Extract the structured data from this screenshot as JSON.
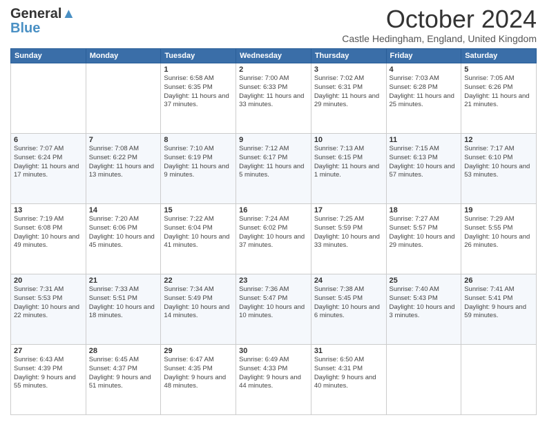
{
  "logo": {
    "line1": "General",
    "line2": "Blue",
    "bird": "▲"
  },
  "title": "October 2024",
  "location": "Castle Hedingham, England, United Kingdom",
  "weekdays": [
    "Sunday",
    "Monday",
    "Tuesday",
    "Wednesday",
    "Thursday",
    "Friday",
    "Saturday"
  ],
  "weeks": [
    [
      {
        "day": "",
        "info": ""
      },
      {
        "day": "",
        "info": ""
      },
      {
        "day": "1",
        "info": "Sunrise: 6:58 AM\nSunset: 6:35 PM\nDaylight: 11 hours and 37 minutes."
      },
      {
        "day": "2",
        "info": "Sunrise: 7:00 AM\nSunset: 6:33 PM\nDaylight: 11 hours and 33 minutes."
      },
      {
        "day": "3",
        "info": "Sunrise: 7:02 AM\nSunset: 6:31 PM\nDaylight: 11 hours and 29 minutes."
      },
      {
        "day": "4",
        "info": "Sunrise: 7:03 AM\nSunset: 6:28 PM\nDaylight: 11 hours and 25 minutes."
      },
      {
        "day": "5",
        "info": "Sunrise: 7:05 AM\nSunset: 6:26 PM\nDaylight: 11 hours and 21 minutes."
      }
    ],
    [
      {
        "day": "6",
        "info": "Sunrise: 7:07 AM\nSunset: 6:24 PM\nDaylight: 11 hours and 17 minutes."
      },
      {
        "day": "7",
        "info": "Sunrise: 7:08 AM\nSunset: 6:22 PM\nDaylight: 11 hours and 13 minutes."
      },
      {
        "day": "8",
        "info": "Sunrise: 7:10 AM\nSunset: 6:19 PM\nDaylight: 11 hours and 9 minutes."
      },
      {
        "day": "9",
        "info": "Sunrise: 7:12 AM\nSunset: 6:17 PM\nDaylight: 11 hours and 5 minutes."
      },
      {
        "day": "10",
        "info": "Sunrise: 7:13 AM\nSunset: 6:15 PM\nDaylight: 11 hours and 1 minute."
      },
      {
        "day": "11",
        "info": "Sunrise: 7:15 AM\nSunset: 6:13 PM\nDaylight: 10 hours and 57 minutes."
      },
      {
        "day": "12",
        "info": "Sunrise: 7:17 AM\nSunset: 6:10 PM\nDaylight: 10 hours and 53 minutes."
      }
    ],
    [
      {
        "day": "13",
        "info": "Sunrise: 7:19 AM\nSunset: 6:08 PM\nDaylight: 10 hours and 49 minutes."
      },
      {
        "day": "14",
        "info": "Sunrise: 7:20 AM\nSunset: 6:06 PM\nDaylight: 10 hours and 45 minutes."
      },
      {
        "day": "15",
        "info": "Sunrise: 7:22 AM\nSunset: 6:04 PM\nDaylight: 10 hours and 41 minutes."
      },
      {
        "day": "16",
        "info": "Sunrise: 7:24 AM\nSunset: 6:02 PM\nDaylight: 10 hours and 37 minutes."
      },
      {
        "day": "17",
        "info": "Sunrise: 7:25 AM\nSunset: 5:59 PM\nDaylight: 10 hours and 33 minutes."
      },
      {
        "day": "18",
        "info": "Sunrise: 7:27 AM\nSunset: 5:57 PM\nDaylight: 10 hours and 29 minutes."
      },
      {
        "day": "19",
        "info": "Sunrise: 7:29 AM\nSunset: 5:55 PM\nDaylight: 10 hours and 26 minutes."
      }
    ],
    [
      {
        "day": "20",
        "info": "Sunrise: 7:31 AM\nSunset: 5:53 PM\nDaylight: 10 hours and 22 minutes."
      },
      {
        "day": "21",
        "info": "Sunrise: 7:33 AM\nSunset: 5:51 PM\nDaylight: 10 hours and 18 minutes."
      },
      {
        "day": "22",
        "info": "Sunrise: 7:34 AM\nSunset: 5:49 PM\nDaylight: 10 hours and 14 minutes."
      },
      {
        "day": "23",
        "info": "Sunrise: 7:36 AM\nSunset: 5:47 PM\nDaylight: 10 hours and 10 minutes."
      },
      {
        "day": "24",
        "info": "Sunrise: 7:38 AM\nSunset: 5:45 PM\nDaylight: 10 hours and 6 minutes."
      },
      {
        "day": "25",
        "info": "Sunrise: 7:40 AM\nSunset: 5:43 PM\nDaylight: 10 hours and 3 minutes."
      },
      {
        "day": "26",
        "info": "Sunrise: 7:41 AM\nSunset: 5:41 PM\nDaylight: 9 hours and 59 minutes."
      }
    ],
    [
      {
        "day": "27",
        "info": "Sunrise: 6:43 AM\nSunset: 4:39 PM\nDaylight: 9 hours and 55 minutes."
      },
      {
        "day": "28",
        "info": "Sunrise: 6:45 AM\nSunset: 4:37 PM\nDaylight: 9 hours and 51 minutes."
      },
      {
        "day": "29",
        "info": "Sunrise: 6:47 AM\nSunset: 4:35 PM\nDaylight: 9 hours and 48 minutes."
      },
      {
        "day": "30",
        "info": "Sunrise: 6:49 AM\nSunset: 4:33 PM\nDaylight: 9 hours and 44 minutes."
      },
      {
        "day": "31",
        "info": "Sunrise: 6:50 AM\nSunset: 4:31 PM\nDaylight: 9 hours and 40 minutes."
      },
      {
        "day": "",
        "info": ""
      },
      {
        "day": "",
        "info": ""
      }
    ]
  ]
}
